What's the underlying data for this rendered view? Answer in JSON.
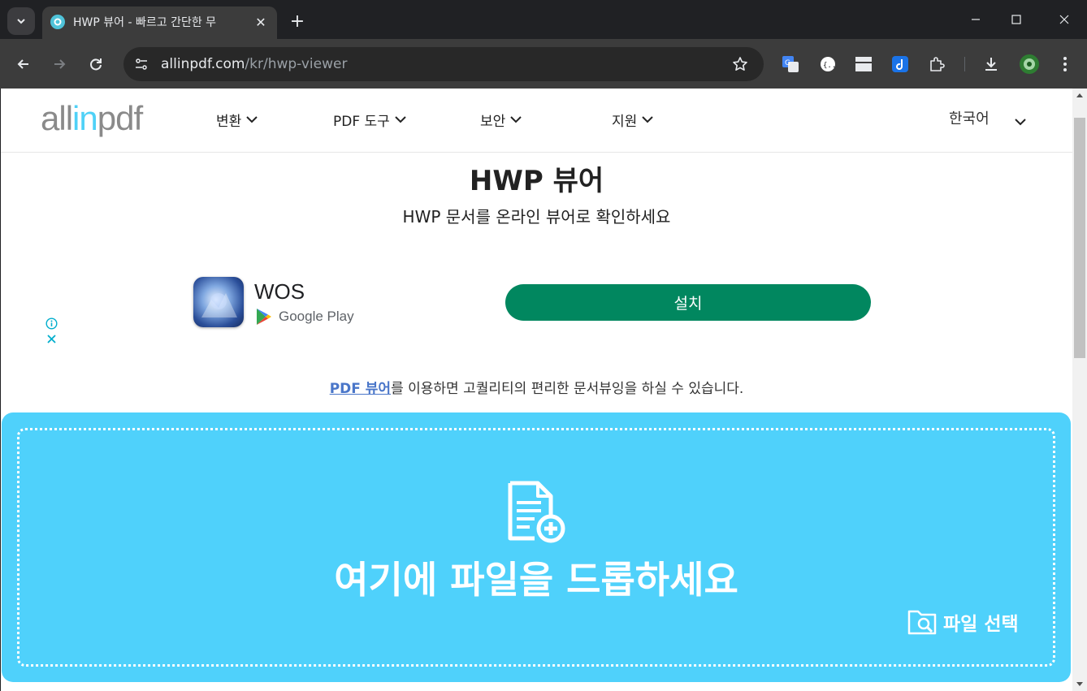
{
  "browser": {
    "tab_title": "HWP 뷰어 - 빠르고 간단한 무",
    "url_host": "allinpdf.com",
    "url_path": "/kr/hwp-viewer"
  },
  "site": {
    "logo": {
      "part1": "all",
      "part2": "in",
      "part3": "pdf"
    },
    "nav": [
      {
        "label": "변환"
      },
      {
        "label": "PDF 도구"
      },
      {
        "label": "보안"
      },
      {
        "label": "지원"
      }
    ],
    "language": "한국어"
  },
  "hero": {
    "title": "HWP 뷰어",
    "subtitle": "HWP 문서를 온라인 뷰어로 확인하세요"
  },
  "ad": {
    "app_name": "WOS",
    "store": "Google Play",
    "install_label": "설치"
  },
  "description": {
    "link": "PDF 뷰어",
    "text": "를 이용하면 고퀄리티의 편리한 문서뷰잉을 하실 수 있습니다."
  },
  "dropzone": {
    "title": "여기에 파일을 드롭하세요",
    "choose_label": "파일 선택"
  },
  "colors": {
    "accent": "#4fd1fb",
    "install": "#01875f",
    "link": "#4a76c9"
  }
}
